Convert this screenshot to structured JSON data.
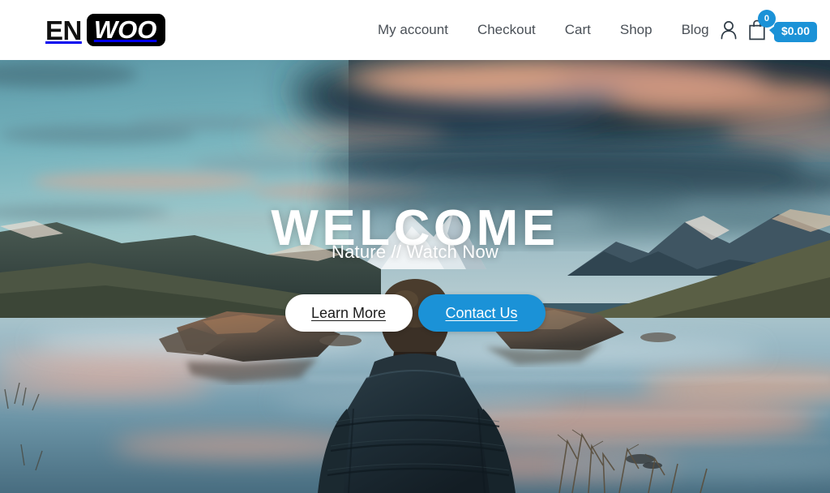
{
  "header": {
    "logo": {
      "part1": "EN",
      "part2": "WOO"
    },
    "nav": [
      {
        "label": "My account",
        "name": "nav-my-account"
      },
      {
        "label": "Checkout",
        "name": "nav-checkout"
      },
      {
        "label": "Cart",
        "name": "nav-cart"
      },
      {
        "label": "Shop",
        "name": "nav-shop"
      },
      {
        "label": "Blog",
        "name": "nav-blog"
      }
    ],
    "account_icon": "user-account-icon",
    "cart": {
      "icon": "shopping-bag-icon",
      "count": "0",
      "total": "$0.00"
    }
  },
  "hero": {
    "title": "WELCOME",
    "subtitle": "Nature // Watch Now",
    "primary_button": "Learn More",
    "secondary_button": "Contact Us",
    "image_description": "Man in dark puffer jacket viewed from behind, standing before a calm mountain lake at dusk with snow-capped peaks and pink-lit clouds"
  },
  "colors": {
    "accent_blue": "#1b92d7",
    "nav_text": "#4a5057",
    "logo_black": "#000000",
    "header_bg": "#ffffff"
  }
}
